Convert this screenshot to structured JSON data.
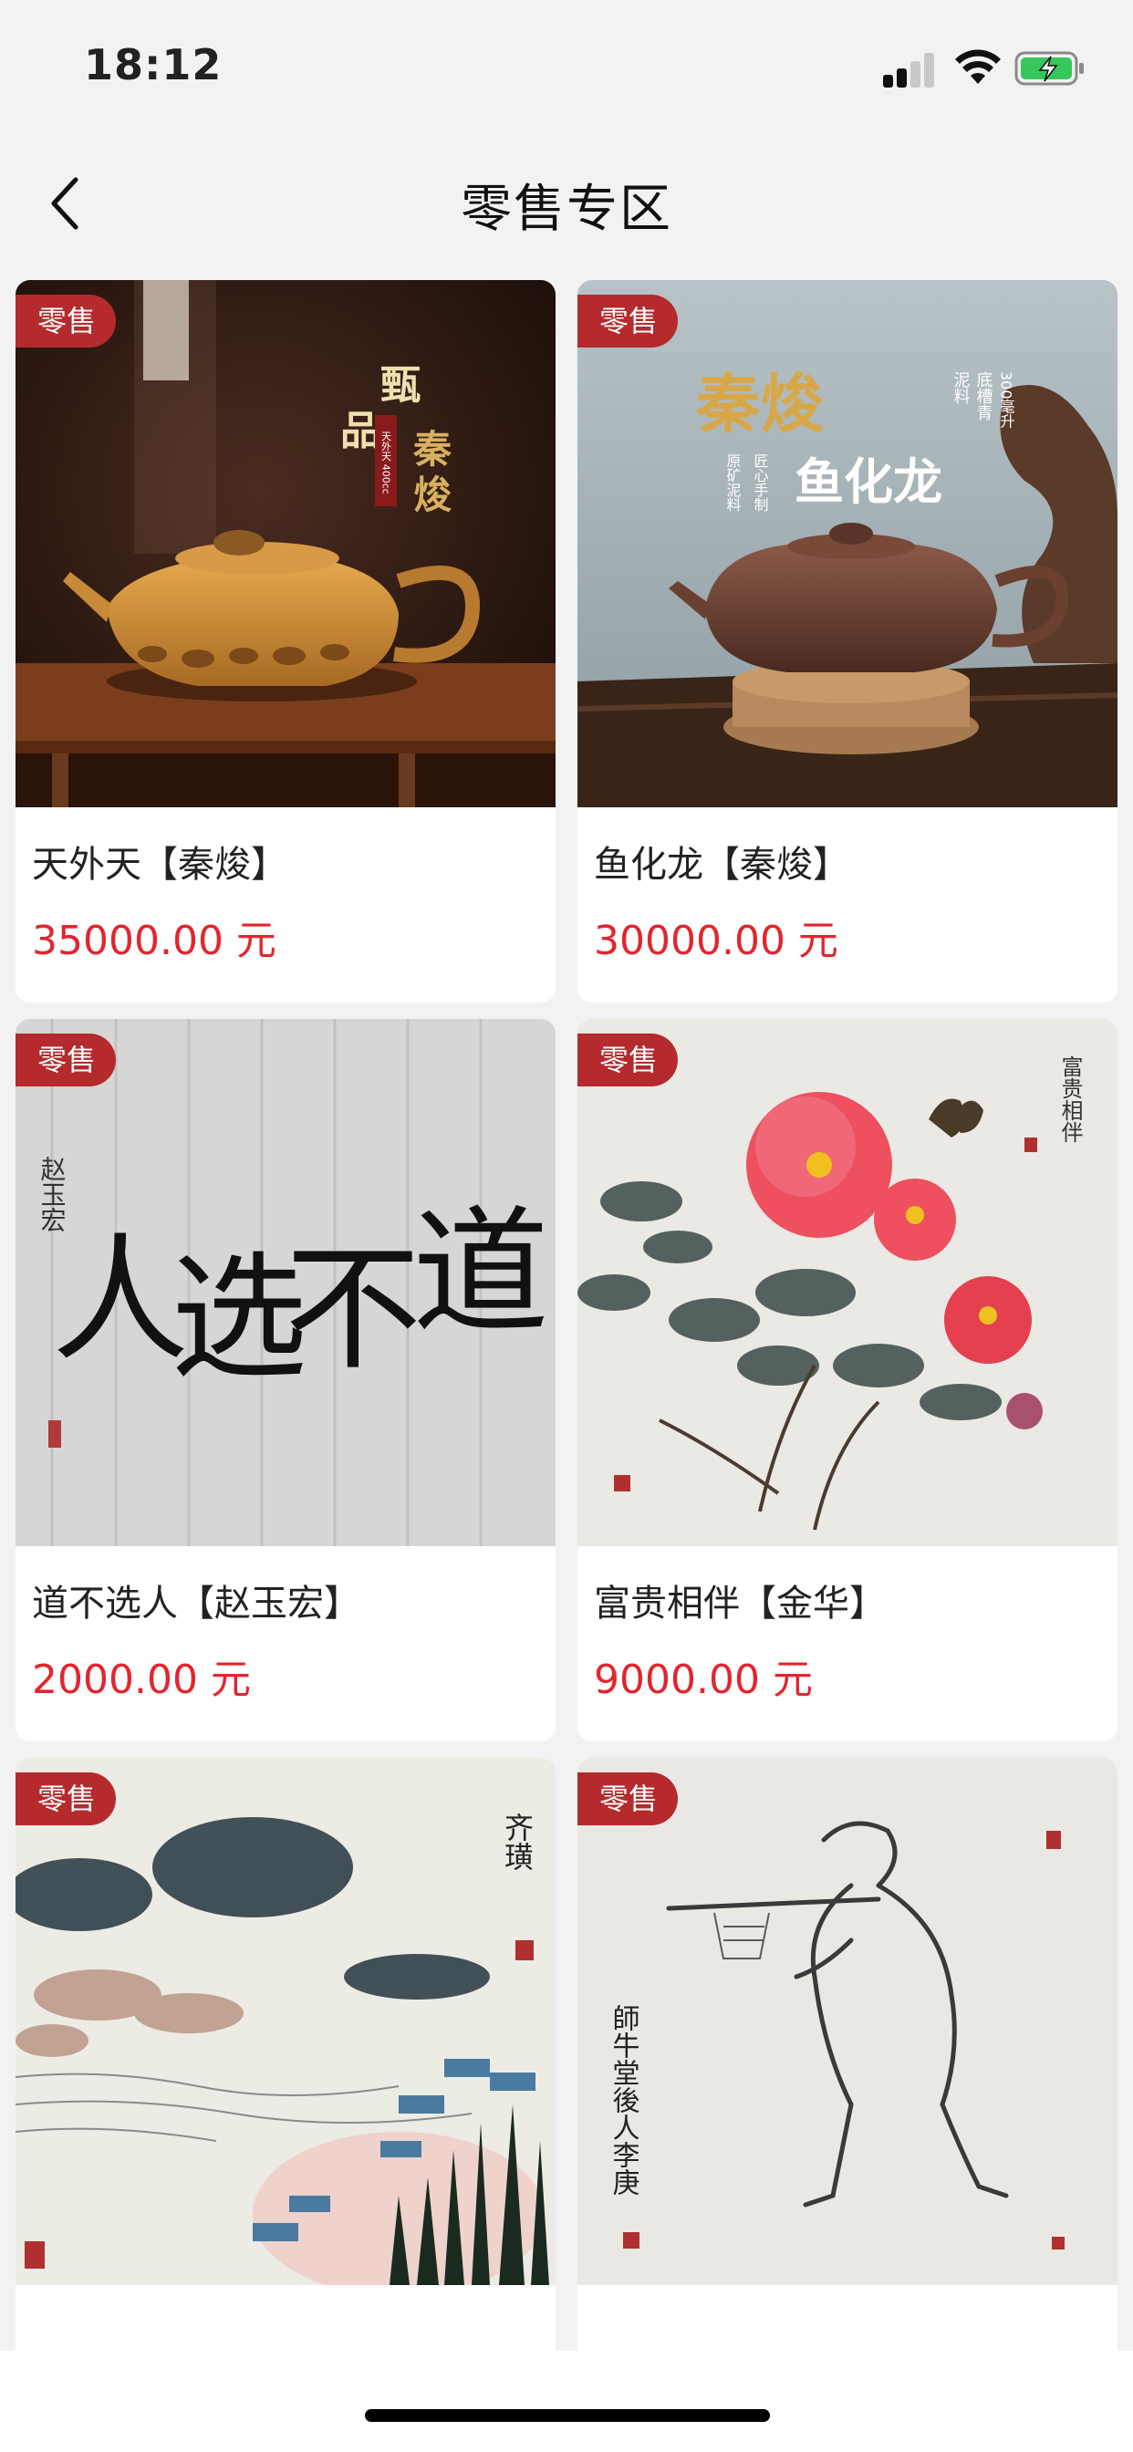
{
  "status_bar": {
    "time": "18:12"
  },
  "nav": {
    "title": "零售专区"
  },
  "products": [
    {
      "badge": "零售",
      "name": "天外天【秦焌】",
      "price": "35000.00 元",
      "image_text": {
        "line1": "甄",
        "line2": "品",
        "line3": "秦",
        "line4": "焌",
        "tag": "天外天 400cc"
      }
    },
    {
      "badge": "零售",
      "name": "鱼化龙【秦焌】",
      "price": "30000.00 元",
      "image_text": {
        "title": "秦焌",
        "subtitle": "鱼化龙",
        "note1": "泥料",
        "note2": "底槽青",
        "note3": "300毫升",
        "note4": "原矿泥料",
        "note5": "匠心手制"
      }
    },
    {
      "badge": "零售",
      "name": "道不选人【赵玉宏】",
      "price": "2000.00 元",
      "image_text": {
        "c1": "道",
        "c2": "不",
        "c3": "选",
        "c4": "人",
        "sig": "赵玉宏"
      }
    },
    {
      "badge": "零售",
      "name": "富贵相伴【金华】",
      "price": "9000.00 元",
      "image_text": {
        "inscription": "富贵相伴"
      }
    },
    {
      "badge": "零售",
      "name": "",
      "price": "",
      "image_text": {
        "inscription": "齐璜"
      }
    },
    {
      "badge": "零售",
      "name": "",
      "price": "",
      "image_text": {
        "inscription": "師牛堂後人李庚"
      }
    }
  ]
}
